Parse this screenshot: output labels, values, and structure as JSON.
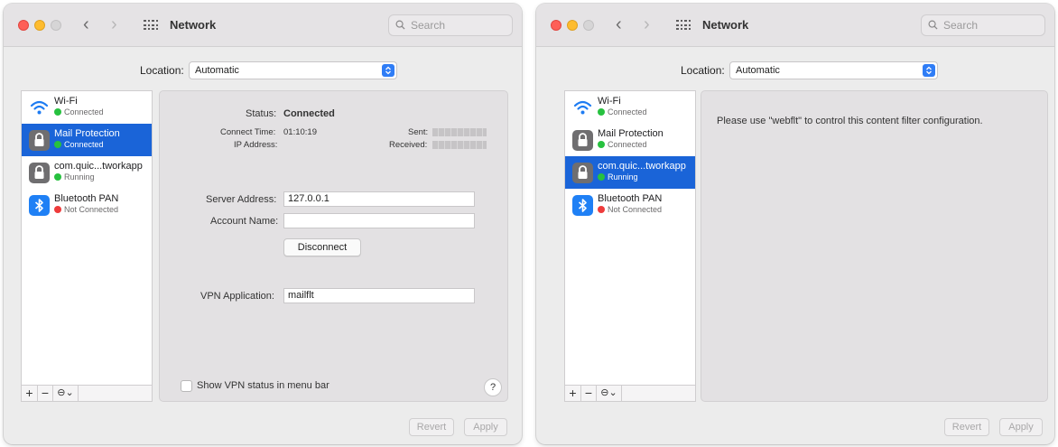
{
  "windows": [
    {
      "title": "Network",
      "search_placeholder": "Search",
      "location_label": "Location:",
      "location_value": "Automatic",
      "services": [
        {
          "name": "Wi-Fi",
          "status": "Connected",
          "status_color": "green",
          "icon": "wifi-icon",
          "selected": false
        },
        {
          "name": "Mail Protection",
          "status": "Connected",
          "status_color": "green",
          "icon": "lock-icon",
          "selected": true
        },
        {
          "name": "com.quic...tworkapp",
          "status": "Running",
          "status_color": "green",
          "icon": "lock-icon",
          "selected": false
        },
        {
          "name": "Bluetooth PAN",
          "status": "Not Connected",
          "status_color": "red",
          "icon": "bluetooth-icon",
          "selected": false
        }
      ],
      "list_bar": {
        "add": "+",
        "remove": "−",
        "action": "⊖⌄"
      },
      "detail": {
        "status_label": "Status:",
        "status_value": "Connected",
        "connect_time_label": "Connect Time:",
        "connect_time_value": "01:10:19",
        "ip_label": "IP Address:",
        "sent_label": "Sent:",
        "received_label": "Received:",
        "server_address_label": "Server Address:",
        "server_address_value": "127.0.0.1",
        "account_name_label": "Account Name:",
        "account_name_value": "",
        "disconnect_label": "Disconnect",
        "vpn_app_label": "VPN Application:",
        "vpn_app_value": "mailflt",
        "show_vpn_label": "Show VPN status in menu bar",
        "help_label": "?"
      },
      "revert_label": "Revert",
      "apply_label": "Apply"
    },
    {
      "title": "Network",
      "search_placeholder": "Search",
      "location_label": "Location:",
      "location_value": "Automatic",
      "services": [
        {
          "name": "Wi-Fi",
          "status": "Connected",
          "status_color": "green",
          "icon": "wifi-icon",
          "selected": false
        },
        {
          "name": "Mail Protection",
          "status": "Connected",
          "status_color": "green",
          "icon": "lock-icon",
          "selected": false
        },
        {
          "name": "com.quic...tworkapp",
          "status": "Running",
          "status_color": "green",
          "icon": "lock-icon",
          "selected": true
        },
        {
          "name": "Bluetooth PAN",
          "status": "Not Connected",
          "status_color": "red",
          "icon": "bluetooth-icon",
          "selected": false
        }
      ],
      "list_bar": {
        "add": "+",
        "remove": "−",
        "action": "⊖⌄"
      },
      "detail": {
        "message": "Please use \"webflt\" to control this content filter configuration."
      },
      "revert_label": "Revert",
      "apply_label": "Apply"
    }
  ],
  "colors": {
    "selection": "#1a64d8",
    "status_green": "#27c13f",
    "status_red": "#ee3b3b",
    "accent_blue": "#2f7df6"
  }
}
